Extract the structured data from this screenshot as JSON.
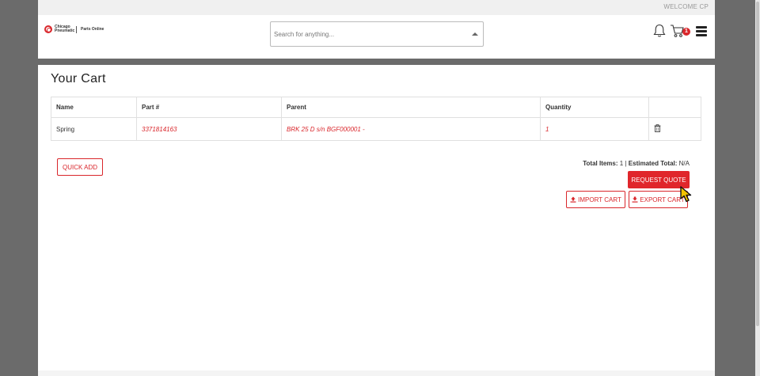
{
  "topbar": {
    "welcome": "WELCOME CP"
  },
  "header": {
    "logo_brand": "Chicago Pneumatic",
    "logo_sub": "Parts Online",
    "search_placeholder": "Search for anything...",
    "cart_count": "1",
    "icons": [
      "bell-icon",
      "cart-icon",
      "hamburger-menu-icon",
      "chevron-up-icon"
    ]
  },
  "main": {
    "title": "Your Cart",
    "columns": [
      "Name",
      "Part #",
      "Parent",
      "Quantity",
      ""
    ],
    "rows": [
      {
        "name": "Spring",
        "part": "3371814163",
        "parent": "BRK 25 D s/n BGF000001 -",
        "quantity": "1"
      }
    ],
    "quick_add": "QUICK ADD",
    "totals_items_label": "Total Items:",
    "totals_items_value": "1",
    "totals_sep": "|",
    "totals_est_label": "Estimated Total:",
    "totals_est_value": "N/A",
    "request_quote": "REQUEST QUOTE",
    "import_cart": "IMPORT CART",
    "export_cart": "EXPORT CART"
  },
  "colors": {
    "accent": "#d9262b",
    "page_bg": "#6b6b6b"
  }
}
